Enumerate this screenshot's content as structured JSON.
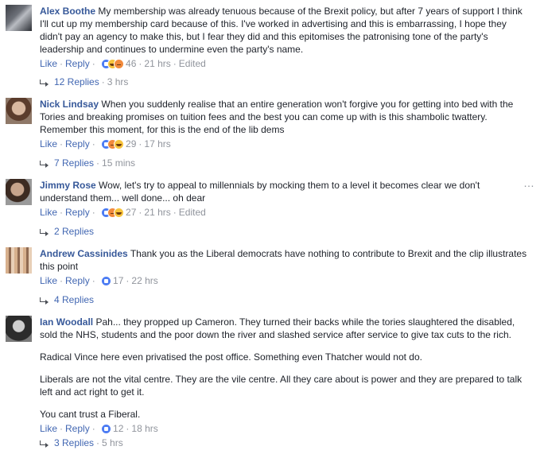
{
  "comments": [
    {
      "author": "Alex Boothe",
      "text": "My membership was already tenuous because of the Brexit policy, but after 7 years of support I think I'll cut up my membership card because of this. I've worked in advertising and this is embarrassing, I hope they didn't pay an agency to make this, but I fear they did and this epitomises the patronising tone of the party's leadership and continues to undermine even the party's name.",
      "like": "Like",
      "reply": "Reply",
      "reactions": [
        "like-icon",
        "haha-icon",
        "angry-icon"
      ],
      "reaction_count": "46",
      "time": "21 hrs",
      "edited": "Edited",
      "replies_count": "12 Replies",
      "replies_time": "3 hrs"
    },
    {
      "author": "Nick Lindsay",
      "text": "When you suddenly realise that an entire generation won't forgive you for getting into bed with the Tories and breaking promises on tuition fees and the best you can come up with is this shambolic twattery. Remember this moment, for this is the end of the lib dems",
      "like": "Like",
      "reply": "Reply",
      "reactions": [
        "like-icon",
        "angry-icon",
        "haha-icon"
      ],
      "reaction_count": "29",
      "time": "17 hrs",
      "replies_count": "7 Replies",
      "replies_time": "15 mins"
    },
    {
      "author": "Jimmy Rose",
      "text": "Wow, let's try to appeal to millennials by mocking them to a level it becomes clear we don't understand them... well done... oh dear",
      "like": "Like",
      "reply": "Reply",
      "reactions": [
        "like-icon",
        "angry-icon",
        "haha-icon"
      ],
      "reaction_count": "27",
      "time": "21 hrs",
      "edited": "Edited",
      "replies_count": "2 Replies"
    },
    {
      "author": "Andrew Cassinides",
      "text": "Thank you as the Liberal democrats have nothing to contribute to Brexit and the clip illustrates this point",
      "like": "Like",
      "reply": "Reply",
      "reactions": [
        "like-icon"
      ],
      "reaction_count": "17",
      "time": "22 hrs",
      "replies_count": "4 Replies"
    },
    {
      "author": "Ian Woodall",
      "text": "Pah... they propped up Cameron. They turned their backs while the tories slaughtered the disabled, sold the NHS, students and the poor down the river and slashed service after service to give tax cuts to the rich.",
      "paragraphs": [
        "Radical Vince here even privatised the post office. Something even Thatcher would not do.",
        "Liberals are not the vital centre. They are the vile centre. All they care about is power and they are prepared to talk left and act right to get it.",
        "You cant trust a Fiberal."
      ],
      "like": "Like",
      "reply": "Reply",
      "reactions": [
        "like-icon"
      ],
      "reaction_count": "12",
      "time": "18 hrs",
      "replies_count": "3 Replies",
      "replies_time": "5 hrs"
    }
  ],
  "more_options": "…",
  "colors": {
    "link": "#365899",
    "action": "#4267b2",
    "meta": "#90949c",
    "text": "#1d2129"
  }
}
